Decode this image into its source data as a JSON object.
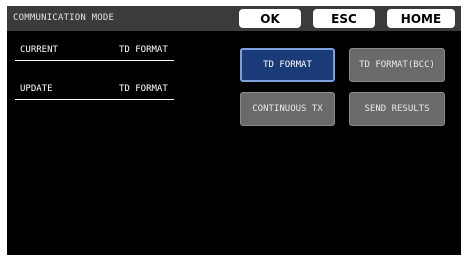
{
  "header": {
    "title": "COMMUNICATION MODE",
    "ok_label": "OK",
    "esc_label": "ESC",
    "home_label": "HOME"
  },
  "status": {
    "current_label": "CURRENT",
    "current_value": "TD FORMAT",
    "update_label": "UPDATE",
    "update_value": "TD FORMAT"
  },
  "options": [
    {
      "label": "TD FORMAT",
      "selected": true
    },
    {
      "label": "TD FORMAT(BCC)",
      "selected": false
    },
    {
      "label": "CONTINUOUS TX",
      "selected": false
    },
    {
      "label": "SEND RESULTS",
      "selected": false
    }
  ]
}
